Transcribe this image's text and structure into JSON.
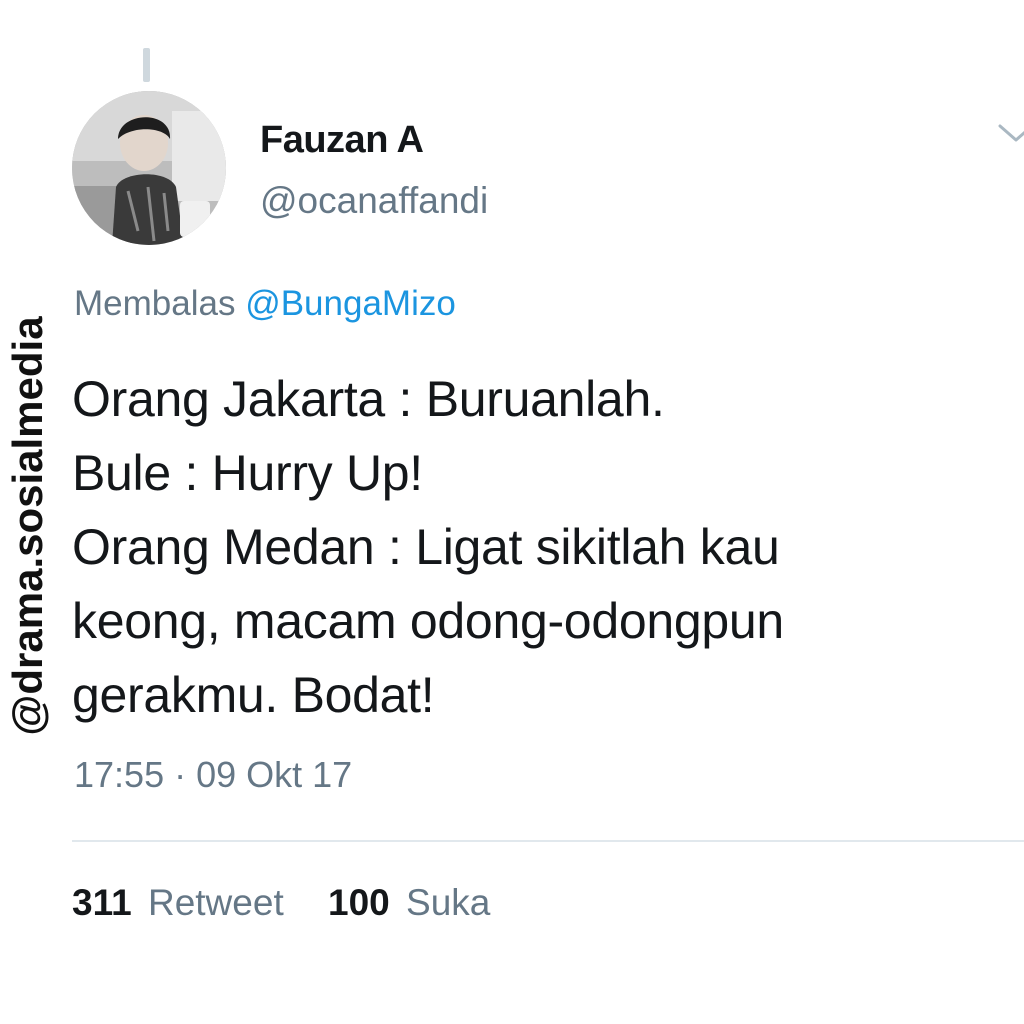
{
  "tweet": {
    "author": {
      "display_name": "Fauzan A",
      "handle": "@ocanaffandi"
    },
    "reply_prefix": "Membalas",
    "reply_to": "@BungaMizo",
    "lines": [
      "Orang Jakarta : Buruanlah.",
      "Bule : Hurry Up!",
      "Orang Medan : Ligat sikitlah kau",
      "keong, macam odong-odongpun",
      "gerakmu. Bodat!"
    ],
    "timestamp": "17:55 · 09 Okt 17",
    "stats": {
      "retweet_count": "311",
      "retweet_label": "Retweet",
      "like_count": "100",
      "like_label": "Suka"
    }
  },
  "watermark": "@drama.sosialmedia",
  "icons": {
    "menu": "chevron-down-icon",
    "avatar": "avatar"
  },
  "colors": {
    "text": "#14171a",
    "secondary": "#657786",
    "link": "#1b95e0",
    "divider": "#e1e8ed"
  }
}
